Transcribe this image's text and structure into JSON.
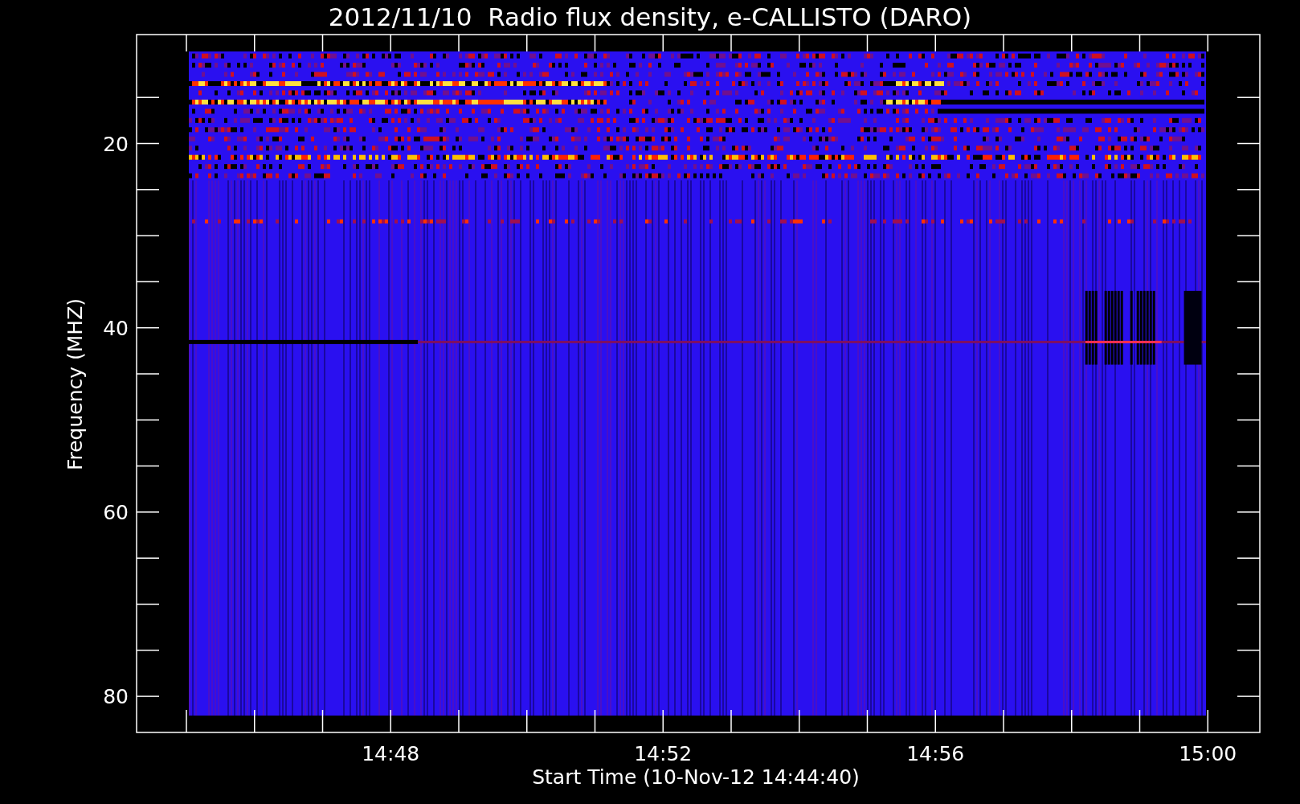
{
  "title": "2012/11/10  Radio flux density, e-CALLISTO (DARO)",
  "ylabel": "Frequency (MHZ)",
  "xlabel": "Start Time (10-Nov-12 14:44:40)",
  "yticks": [
    "20",
    "40",
    "60",
    "80"
  ],
  "xticks": [
    "14:48",
    "14:52",
    "14:56",
    "15:00"
  ]
}
